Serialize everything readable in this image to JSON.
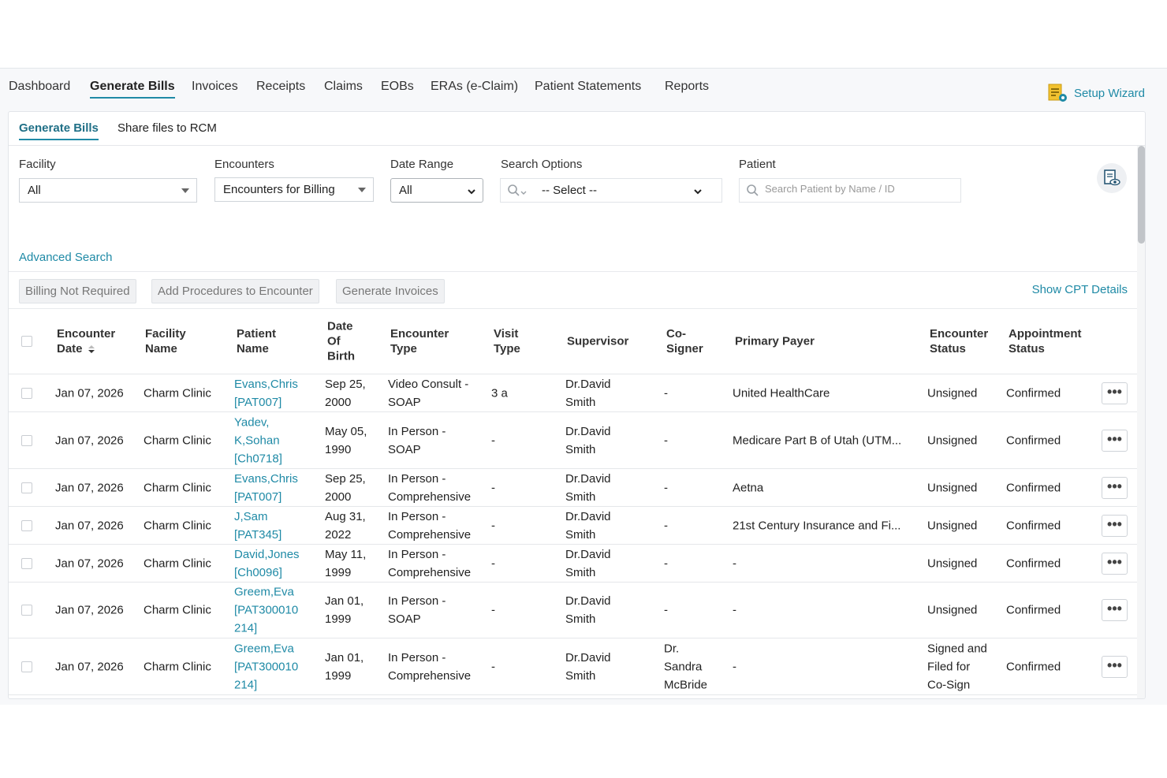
{
  "nav": {
    "items": [
      "Dashboard",
      "Generate Bills",
      "Invoices",
      "Receipts",
      "Claims",
      "EOBs",
      "ERAs (e-Claim)",
      "Patient Statements",
      "Reports"
    ],
    "active": "Generate Bills",
    "setup_wizard": "Setup Wizard"
  },
  "subtabs": {
    "generate_bills": "Generate Bills",
    "share_files": "Share files to RCM"
  },
  "filters": {
    "facility": {
      "label": "Facility",
      "value": "All"
    },
    "encounters": {
      "label": "Encounters",
      "value": "Encounters for Billing"
    },
    "date_range": {
      "label": "Date Range",
      "value": "All"
    },
    "search_options": {
      "label": "Search Options",
      "value": "-- Select --"
    },
    "patient": {
      "label": "Patient",
      "placeholder": "Search Patient by Name / ID"
    }
  },
  "advanced_search": "Advanced Search",
  "actions": {
    "billing_not_required": "Billing Not Required",
    "add_procedures": "Add Procedures to Encounter",
    "generate_invoices": "Generate Invoices",
    "show_cpt": "Show CPT Details"
  },
  "columns": {
    "encounter_date": [
      "Encounter",
      "Date"
    ],
    "facility_name": [
      "Facility",
      "Name"
    ],
    "patient_name": [
      "Patient",
      "Name"
    ],
    "dob": [
      "Date",
      "Of",
      "Birth"
    ],
    "encounter_type": [
      "Encounter",
      "Type"
    ],
    "visit_type": [
      "Visit",
      "Type"
    ],
    "supervisor": [
      "Supervisor"
    ],
    "cosigner": [
      "Co-",
      "Signer"
    ],
    "primary_payer": [
      "Primary Payer"
    ],
    "encounter_status": [
      "Encounter",
      "Status"
    ],
    "appointment_status": [
      "Appointment",
      "Status"
    ]
  },
  "rows": [
    {
      "date": "Jan 07, 2026",
      "facility": "Charm Clinic",
      "patient": [
        "Evans,Chris",
        "[PAT007]"
      ],
      "dob": [
        "Sep 25,",
        "2000"
      ],
      "enc_type": [
        "Video Consult -",
        "SOAP"
      ],
      "visit": "3 a",
      "supervisor": [
        "Dr.David",
        "Smith"
      ],
      "cosigner": [
        "-"
      ],
      "payer": "United HealthCare",
      "enc_status": [
        "Unsigned"
      ],
      "appt_status": "Confirmed"
    },
    {
      "date": "Jan 07, 2026",
      "facility": "Charm Clinic",
      "patient": [
        "Yadev,",
        "K,Sohan",
        "[Ch0718]"
      ],
      "dob": [
        "May 05,",
        "1990"
      ],
      "enc_type": [
        "In Person -",
        "SOAP"
      ],
      "visit": "-",
      "supervisor": [
        "Dr.David",
        "Smith"
      ],
      "cosigner": [
        "-"
      ],
      "payer": "Medicare Part B of Utah (UTM...",
      "enc_status": [
        "Unsigned"
      ],
      "appt_status": "Confirmed"
    },
    {
      "date": "Jan 07, 2026",
      "facility": "Charm Clinic",
      "patient": [
        "Evans,Chris",
        "[PAT007]"
      ],
      "dob": [
        "Sep 25,",
        "2000"
      ],
      "enc_type": [
        "In Person -",
        "Comprehensive"
      ],
      "visit": "-",
      "supervisor": [
        "Dr.David",
        "Smith"
      ],
      "cosigner": [
        "-"
      ],
      "payer": "Aetna",
      "enc_status": [
        "Unsigned"
      ],
      "appt_status": "Confirmed"
    },
    {
      "date": "Jan 07, 2026",
      "facility": "Charm Clinic",
      "patient": [
        "J,Sam",
        "[PAT345]"
      ],
      "dob": [
        "Aug 31,",
        "2022"
      ],
      "enc_type": [
        "In Person -",
        "Comprehensive"
      ],
      "visit": "-",
      "supervisor": [
        "Dr.David",
        "Smith"
      ],
      "cosigner": [
        "-"
      ],
      "payer": "21st Century Insurance and Fi...",
      "enc_status": [
        "Unsigned"
      ],
      "appt_status": "Confirmed"
    },
    {
      "date": "Jan 07, 2026",
      "facility": "Charm Clinic",
      "patient": [
        "David,Jones",
        "[Ch0096]"
      ],
      "dob": [
        "May 11,",
        "1999"
      ],
      "enc_type": [
        "In Person -",
        "Comprehensive"
      ],
      "visit": "-",
      "supervisor": [
        "Dr.David",
        "Smith"
      ],
      "cosigner": [
        "-"
      ],
      "payer": "-",
      "enc_status": [
        "Unsigned"
      ],
      "appt_status": "Confirmed"
    },
    {
      "date": "Jan 07, 2026",
      "facility": "Charm Clinic",
      "patient": [
        "Greem,Eva",
        "[PAT300010",
        "214]"
      ],
      "dob": [
        "Jan 01,",
        "1999"
      ],
      "enc_type": [
        "In Person -",
        "SOAP"
      ],
      "visit": "-",
      "supervisor": [
        "Dr.David",
        "Smith"
      ],
      "cosigner": [
        "-"
      ],
      "payer": "-",
      "enc_status": [
        "Unsigned"
      ],
      "appt_status": "Confirmed"
    },
    {
      "date": "Jan 07, 2026",
      "facility": "Charm Clinic",
      "patient": [
        "Greem,Eva",
        "[PAT300010",
        "214]"
      ],
      "dob": [
        "Jan 01,",
        "1999"
      ],
      "enc_type": [
        "In Person -",
        "Comprehensive"
      ],
      "visit": "-",
      "supervisor": [
        "Dr.David",
        "Smith"
      ],
      "cosigner": [
        "Dr.",
        "Sandra",
        "McBride"
      ],
      "payer": "-",
      "enc_status": [
        "Signed and",
        "Filed for",
        "Co-Sign"
      ],
      "appt_status": "Confirmed"
    }
  ],
  "row_menu": "•••",
  "colors": {
    "accent": "#1f8aa6",
    "link": "#1f8aa6",
    "border": "#e5e7ea"
  }
}
